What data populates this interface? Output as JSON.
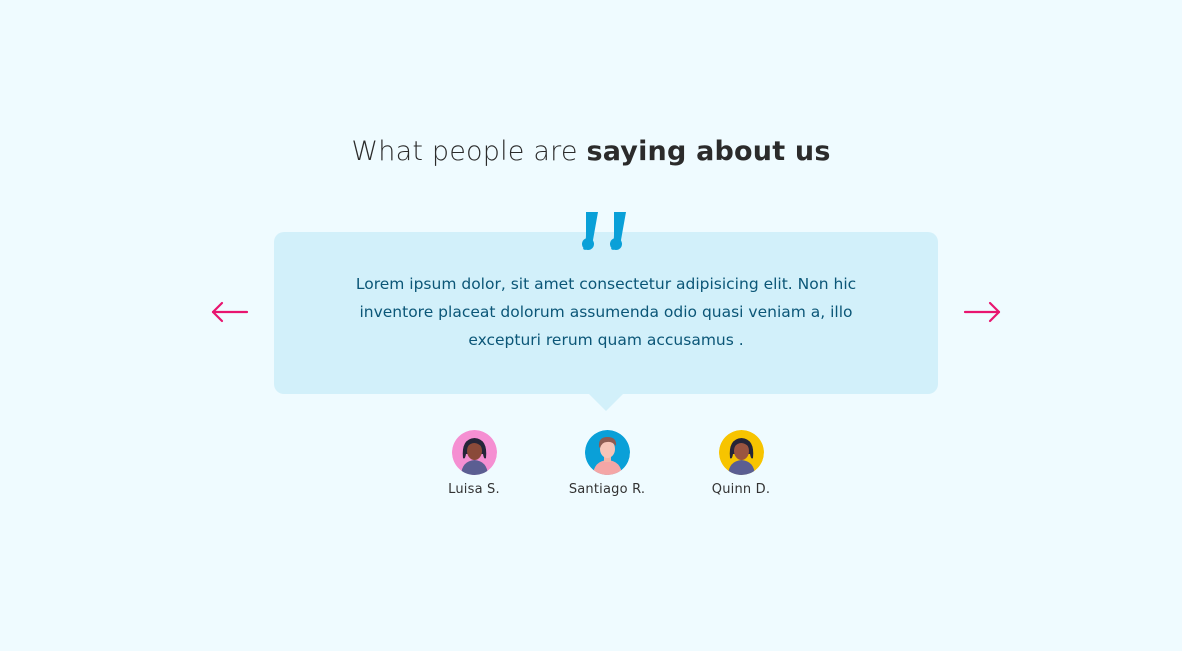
{
  "heading": {
    "light": "What people are ",
    "bold": "saying about us"
  },
  "testimonial": {
    "text": "Lorem ipsum dolor, sit amet consectetur adipisicing elit. Non hic inventore placeat dolorum assumenda odio quasi veniam a, illo excepturi rerum quam accusamus ."
  },
  "navigation": {
    "prev_icon": "arrow-left-icon",
    "next_icon": "arrow-right-icon"
  },
  "people": [
    {
      "name": "Luisa S.",
      "avatar_bg": "#f58fd2"
    },
    {
      "name": "Santiago R.",
      "avatar_bg": "#0aa0d8"
    },
    {
      "name": "Quinn D.",
      "avatar_bg": "#f7c400"
    }
  ],
  "colors": {
    "background": "#effbff",
    "bubble": "#d2f0fa",
    "quote_text": "#0b5677",
    "quote_mark": "#0aa0d8",
    "arrows": "#e8156f"
  }
}
